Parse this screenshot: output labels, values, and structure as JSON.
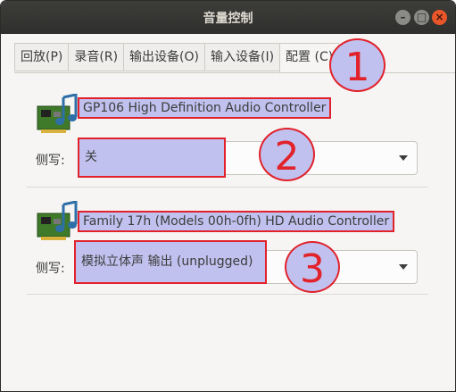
{
  "window": {
    "title": "音量控制"
  },
  "window_buttons": {
    "minimize": "–",
    "maximize": "□",
    "close": "×"
  },
  "tabs": [
    {
      "label": "回放(P)"
    },
    {
      "label": "录音(R)"
    },
    {
      "label": "输出设备(O)"
    },
    {
      "label": "输入设备(I)"
    },
    {
      "label": "配置 (C)"
    }
  ],
  "cards": [
    {
      "device_name": "GP106 High Definition Audio Controller",
      "profile_label": "侧写:",
      "profile_value": "关"
    },
    {
      "device_name": "Family 17h (Models 00h-0fh) HD Audio Controller",
      "profile_label": "侧写:",
      "profile_value": "模拟立体声 输出 (unplugged)"
    }
  ],
  "annotations": [
    "1",
    "2",
    "3"
  ],
  "colors": {
    "highlight_fill": "#c1c1ef",
    "highlight_border": "#e1222b",
    "titlebar": "#2f2f2d"
  },
  "icons": {
    "device": "sound-card-icon",
    "dropdown": "chevron-down-icon"
  }
}
